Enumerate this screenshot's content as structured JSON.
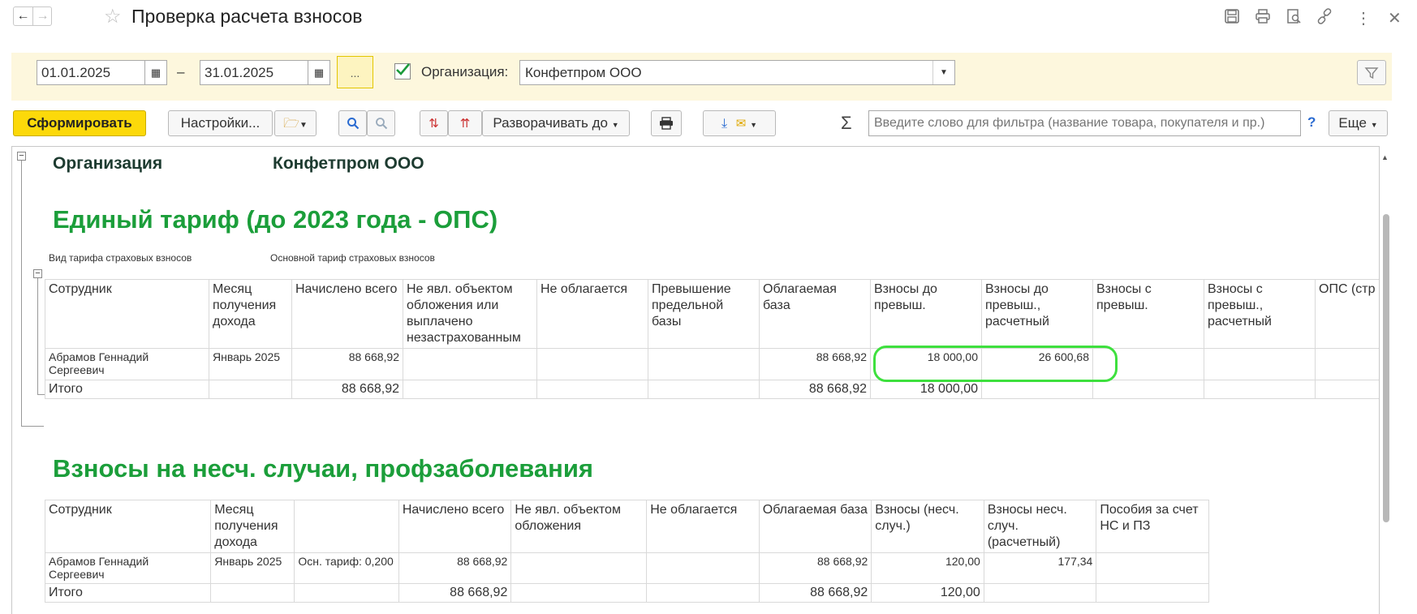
{
  "window": {
    "title": "Проверка расчета взносов"
  },
  "filters": {
    "date_from": "01.01.2025",
    "date_to": "31.01.2025",
    "dash": "–",
    "more_label": "...",
    "org_label": "Организация:",
    "org_value": "Конфетпром ООО"
  },
  "toolbar": {
    "generate": "Сформировать",
    "settings": "Настройки...",
    "expand_to": "Разворачивать до",
    "sigma": "Σ",
    "search_placeholder": "Введите слово для фильтра (название товара, покупателя и пр.)",
    "help": "?",
    "more": "Еще"
  },
  "report": {
    "org_label": "Организация",
    "org_value": "Конфетпром ООО",
    "section1": {
      "title": "Единый тариф (до 2023 года - ОПС)",
      "tariff_label": "Вид тарифа страховых взносов",
      "tariff_value": "Основной тариф страховых взносов",
      "headers": [
        "Сотрудник",
        "Месяц получения дохода",
        "Начислено всего",
        "Не явл. объектом обложения или выплачено незастрахованным",
        "Не облагается",
        "Превышение предельной базы",
        "Облагаемая база",
        "Взносы до превыш.",
        "Взносы до превыш., расчетный",
        "Взносы с превыш.",
        "Взносы с превыш., расчетный",
        "ОПС (стр"
      ],
      "row": [
        "Абрамов Геннадий Сергеевич",
        "Январь 2025",
        "88 668,92",
        "",
        "",
        "",
        "88 668,92",
        "18 000,00",
        "26 600,68",
        "",
        "",
        ""
      ],
      "total": [
        "Итого",
        "",
        "88 668,92",
        "",
        "",
        "",
        "88 668,92",
        "18 000,00",
        "",
        "",
        "",
        ""
      ]
    },
    "section2": {
      "title": "Взносы на несч. случаи, профзаболевания",
      "headers": [
        "Сотрудник",
        "Месяц получения дохода",
        "",
        "Начислено всего",
        "Не явл. объектом обложения",
        "Не облагается",
        "Облагаемая база",
        "Взносы (несч. случ.)",
        "Взносы несч. случ. (расчетный)",
        "Пособия за счет НС и ПЗ"
      ],
      "row": [
        "Абрамов Геннадий Сергеевич",
        "Январь 2025",
        "Осн. тариф: 0,200",
        "88 668,92",
        "",
        "",
        "88 668,92",
        "120,00",
        "177,34",
        ""
      ],
      "total": [
        "Итого",
        "",
        "",
        "88 668,92",
        "",
        "",
        "88 668,92",
        "120,00",
        "",
        ""
      ]
    }
  },
  "colors": {
    "accent": "#fcd90a",
    "section_title": "#1b9e3a",
    "highlight": "#3ee03e",
    "mismatch": "#e00000"
  }
}
